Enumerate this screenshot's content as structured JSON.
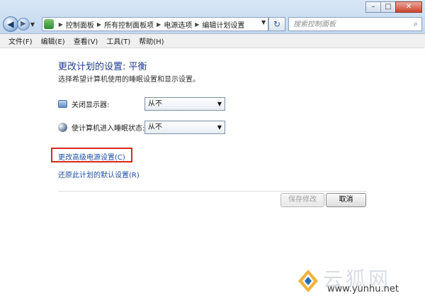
{
  "window": {
    "minimize_label": "–",
    "maximize_label": "□",
    "close_label": "✕"
  },
  "nav": {
    "back_glyph": "◀",
    "forward_glyph": "▶",
    "dropdown_glyph": "▼",
    "refresh_glyph": "↻"
  },
  "address_bar": {
    "breadcrumbs": [
      "控制面板",
      "所有控制面板项",
      "电源选项",
      "编辑计划设置"
    ],
    "separator": "▶",
    "dropdown_glyph": "▼"
  },
  "search": {
    "placeholder": "搜索控制面板",
    "icon_glyph": "⌕"
  },
  "menu": {
    "items": [
      "文件(F)",
      "编辑(E)",
      "查看(V)",
      "工具(T)",
      "帮助(H)"
    ]
  },
  "main": {
    "title": "更改计划的设置: 平衡",
    "subtitle": "选择希望计算机使用的睡眠设置和显示设置。",
    "settings": [
      {
        "label": "关闭显示器:",
        "value": "从不",
        "icon": "monitor-icon"
      },
      {
        "label": "使计算机进入睡眠状态:",
        "value": "从不",
        "icon": "moon-icon"
      }
    ],
    "select_arrow": "▼",
    "links": {
      "advanced": "更改高级电源设置(C)",
      "restore": "还原此计划的默认设置(R)"
    },
    "buttons": {
      "save": "保存修改",
      "cancel": "取消"
    }
  },
  "watermark": {
    "brand": "云狐网",
    "url": "www.yunhu.net"
  },
  "colors": {
    "title": "#1e3d8f",
    "link": "#1f4fa3",
    "highlight": "#d9281d"
  }
}
